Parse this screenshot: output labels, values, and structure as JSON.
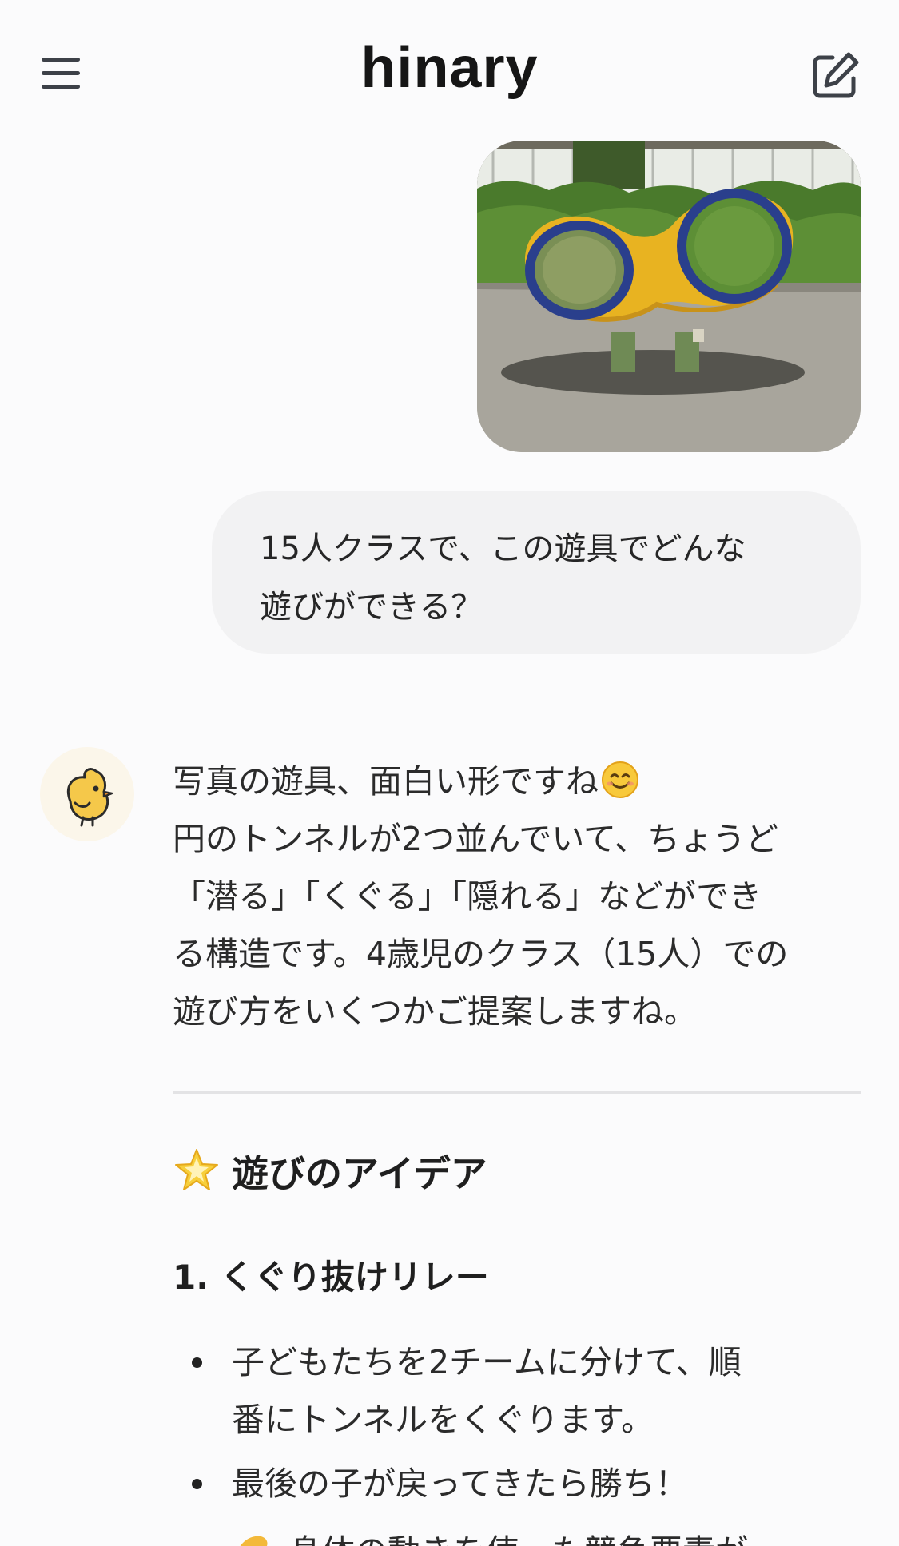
{
  "header": {
    "app_name": "hinary",
    "menu_icon": "hamburger-menu-icon",
    "compose_icon": "new-chat-pencil-icon"
  },
  "user": {
    "photo_description_icon": "playground-equipment-photo",
    "message_lines": [
      "15人クラスで、この遊具でどんな",
      "遊びができる？"
    ]
  },
  "assistant": {
    "avatar_icon": "chick-icon",
    "intro_lines": [
      "写真の遊具、面白い形ですね",
      "円のトンネルが2つ並んでいて、ちょうど",
      "「潜る」「くぐる」「隠れる」などができ",
      "る構造です。4歳児のクラス（15人）での",
      "遊び方をいくつかご提案しますね。"
    ],
    "section_title": "遊びのアイデア",
    "idea_1_title": "1. くぐり抜けリレー",
    "bullets": [
      [
        "子どもたちを2チームに分けて、順",
        "番にトンネルをくぐります。"
      ],
      [
        "最後の子が戻ってきたら勝ち！"
      ]
    ],
    "cut_off_line": "身体の動きを使った競争要素が"
  },
  "colors": {
    "background": "#fbfbfc",
    "bubble": "#f2f2f3",
    "equipment_yellow": "#e8b321",
    "equipment_blue": "#2a3f8c"
  }
}
